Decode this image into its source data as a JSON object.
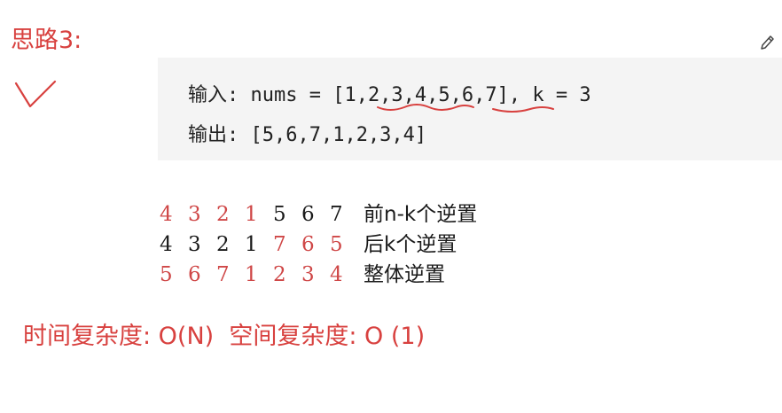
{
  "heading": "思路3:",
  "code_block": {
    "input_line": "输入: nums = [1,2,3,4,5,6,7], k = 3",
    "output_line": "输出: [5,6,7,1,2,3,4]"
  },
  "steps": [
    {
      "digits": [
        {
          "value": "4",
          "color": "red"
        },
        {
          "value": "3",
          "color": "red"
        },
        {
          "value": "2",
          "color": "red"
        },
        {
          "value": "1",
          "color": "red"
        },
        {
          "value": "5",
          "color": "black"
        },
        {
          "value": "6",
          "color": "black"
        },
        {
          "value": "7",
          "color": "black"
        }
      ],
      "label": "前n-k个逆置"
    },
    {
      "digits": [
        {
          "value": "4",
          "color": "black"
        },
        {
          "value": "3",
          "color": "black"
        },
        {
          "value": "2",
          "color": "black"
        },
        {
          "value": "1",
          "color": "black"
        },
        {
          "value": "7",
          "color": "red"
        },
        {
          "value": "6",
          "color": "red"
        },
        {
          "value": "5",
          "color": "red"
        }
      ],
      "label": "后k个逆置"
    },
    {
      "digits": [
        {
          "value": "5",
          "color": "red"
        },
        {
          "value": "6",
          "color": "red"
        },
        {
          "value": "7",
          "color": "red"
        },
        {
          "value": "1",
          "color": "red"
        },
        {
          "value": "2",
          "color": "red"
        },
        {
          "value": "3",
          "color": "red"
        },
        {
          "value": "4",
          "color": "red"
        }
      ],
      "label": "整体逆置"
    }
  ],
  "complexity": "时间复杂度: O(N)  空间复杂度: O (1)",
  "colors": {
    "accent_red": "#d8413f",
    "digit_red": "#cf4747",
    "text_dark": "#1a1a1a",
    "code_bg": "#f4f4f4"
  },
  "icons": {
    "edit": "pencil-icon",
    "check": "check-mark"
  }
}
